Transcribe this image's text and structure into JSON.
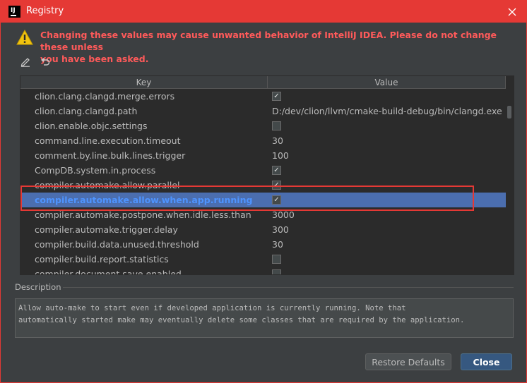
{
  "window": {
    "title": "Registry",
    "app_icon_text": "IJ"
  },
  "warning": {
    "line1": "Changing these values may cause unwanted behavior of IntelliJ IDEA. Please do not change these unless",
    "line2": "you have been asked.",
    "color": "#ff5a5a"
  },
  "toolbar": {
    "edit_icon": "pencil-icon",
    "revert_icon": "undo-icon"
  },
  "table": {
    "columns": [
      "Key",
      "Value"
    ],
    "rows": [
      {
        "key": "clion.clang.clangd.merge.errors",
        "type": "checkbox",
        "checked": true
      },
      {
        "key": "clion.clang.clangd.path",
        "type": "text",
        "value": "D:/dev/clion/llvm/cmake-build-debug/bin/clangd.exe"
      },
      {
        "key": "clion.enable.objc.settings",
        "type": "checkbox",
        "checked": false
      },
      {
        "key": "command.line.execution.timeout",
        "type": "text",
        "value": "30"
      },
      {
        "key": "comment.by.line.bulk.lines.trigger",
        "type": "text",
        "value": "100"
      },
      {
        "key": "CompDB.system.in.process",
        "type": "checkbox",
        "checked": true
      },
      {
        "key": "compiler.automake.allow.parallel",
        "type": "checkbox",
        "checked": true
      },
      {
        "key": "compiler.automake.allow.when.app.running",
        "type": "checkbox",
        "checked": true,
        "selected": true
      },
      {
        "key": "compiler.automake.postpone.when.idle.less.than",
        "type": "text",
        "value": "3000"
      },
      {
        "key": "compiler.automake.trigger.delay",
        "type": "text",
        "value": "300"
      },
      {
        "key": "compiler.build.data.unused.threshold",
        "type": "text",
        "value": "30"
      },
      {
        "key": "compiler.build.report.statistics",
        "type": "checkbox",
        "checked": false
      },
      {
        "key": "compiler.document.save.enabled",
        "type": "checkbox",
        "checked": false
      }
    ]
  },
  "description": {
    "label": "Description",
    "text": "Allow auto-make to start even if developed application is currently running. Note that\nautomatically started make may eventually delete some classes that are required by the application."
  },
  "buttons": {
    "restore": "Restore Defaults",
    "close": "Close"
  },
  "colors": {
    "title_bar": "#e53935",
    "selection": "#4b6eaf",
    "selected_key_text": "#4e94ff",
    "highlight_outline": "#e53935",
    "close_button": "#365880"
  }
}
